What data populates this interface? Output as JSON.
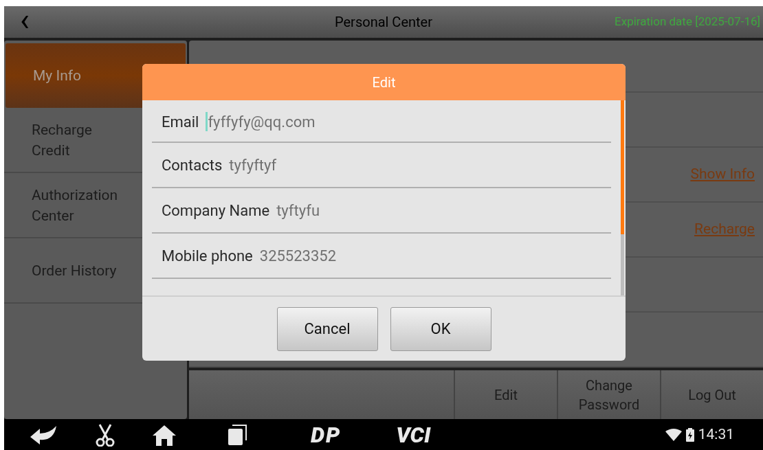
{
  "header": {
    "back": "‹",
    "title": "Personal Center",
    "expiration": "Expiration date [2025-07-16]"
  },
  "sidebar": {
    "items": [
      {
        "label": "My Info",
        "selected": true
      },
      {
        "label": "Recharge Credit",
        "selected": false
      },
      {
        "label": "Authorization Center",
        "selected": false
      },
      {
        "label": "Order History",
        "selected": false
      }
    ]
  },
  "info_links": [
    "Show Info",
    "Recharge"
  ],
  "actions": [
    "Edit",
    "Change Password",
    "Log Out"
  ],
  "dialog": {
    "title": "Edit",
    "fields": [
      {
        "label": "Email",
        "value": "fyffyfy@qq.com",
        "focused": true
      },
      {
        "label": "Contacts",
        "value": "tyfyftyf",
        "focused": false
      },
      {
        "label": "Company Name",
        "value": "tyftyfu",
        "focused": false
      },
      {
        "label": "Mobile phone",
        "value": "325523352",
        "focused": false
      }
    ],
    "buttons": [
      "Cancel",
      "OK"
    ]
  },
  "nav_bar": {
    "logos": [
      "DP",
      "VCI"
    ],
    "time": "14:31"
  }
}
